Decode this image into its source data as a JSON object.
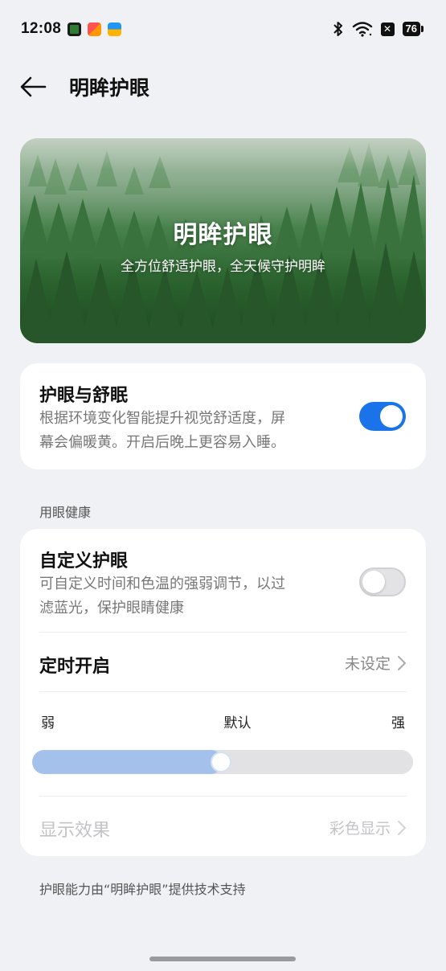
{
  "status_bar": {
    "time": "12:08",
    "battery": "76",
    "icons": [
      "app-icon-green",
      "app-icon-orange",
      "app-icon-blue",
      "bluetooth-icon",
      "wifi-icon",
      "nfc-icon",
      "battery-icon"
    ]
  },
  "header": {
    "title": "明眸护眼",
    "back_icon": "arrow-left-icon"
  },
  "banner": {
    "title": "明眸护眼",
    "subtitle": "全方位舒适护眼，全天候守护明眸"
  },
  "eye_sleep": {
    "title": "护眼与舒眠",
    "desc_line1": "根据环境变化智能提升视觉舒适度，屏",
    "desc_line2": "幕会偏暖黄。开启后晚上更容易入睡。",
    "enabled": true
  },
  "section": {
    "label": "用眼健康"
  },
  "custom_eye": {
    "title": "自定义护眼",
    "desc_line1": "可自定义时间和色温的强弱调节，以过",
    "desc_line2": "滤蓝光，保护眼睛健康",
    "enabled": false
  },
  "schedule": {
    "label": "定时开启",
    "value": "未设定"
  },
  "intensity": {
    "weak": "弱",
    "default": "默认",
    "strong": "强",
    "level": 0.5
  },
  "display_effect": {
    "label": "显示效果",
    "value": "彩色显示"
  },
  "footer": {
    "note": "护眼能力由“明眸护眼”提供技术支持"
  },
  "colors": {
    "accent": "#1a73e8",
    "slider_fill": "#a4c1ec",
    "background": "#f0f1f5"
  }
}
